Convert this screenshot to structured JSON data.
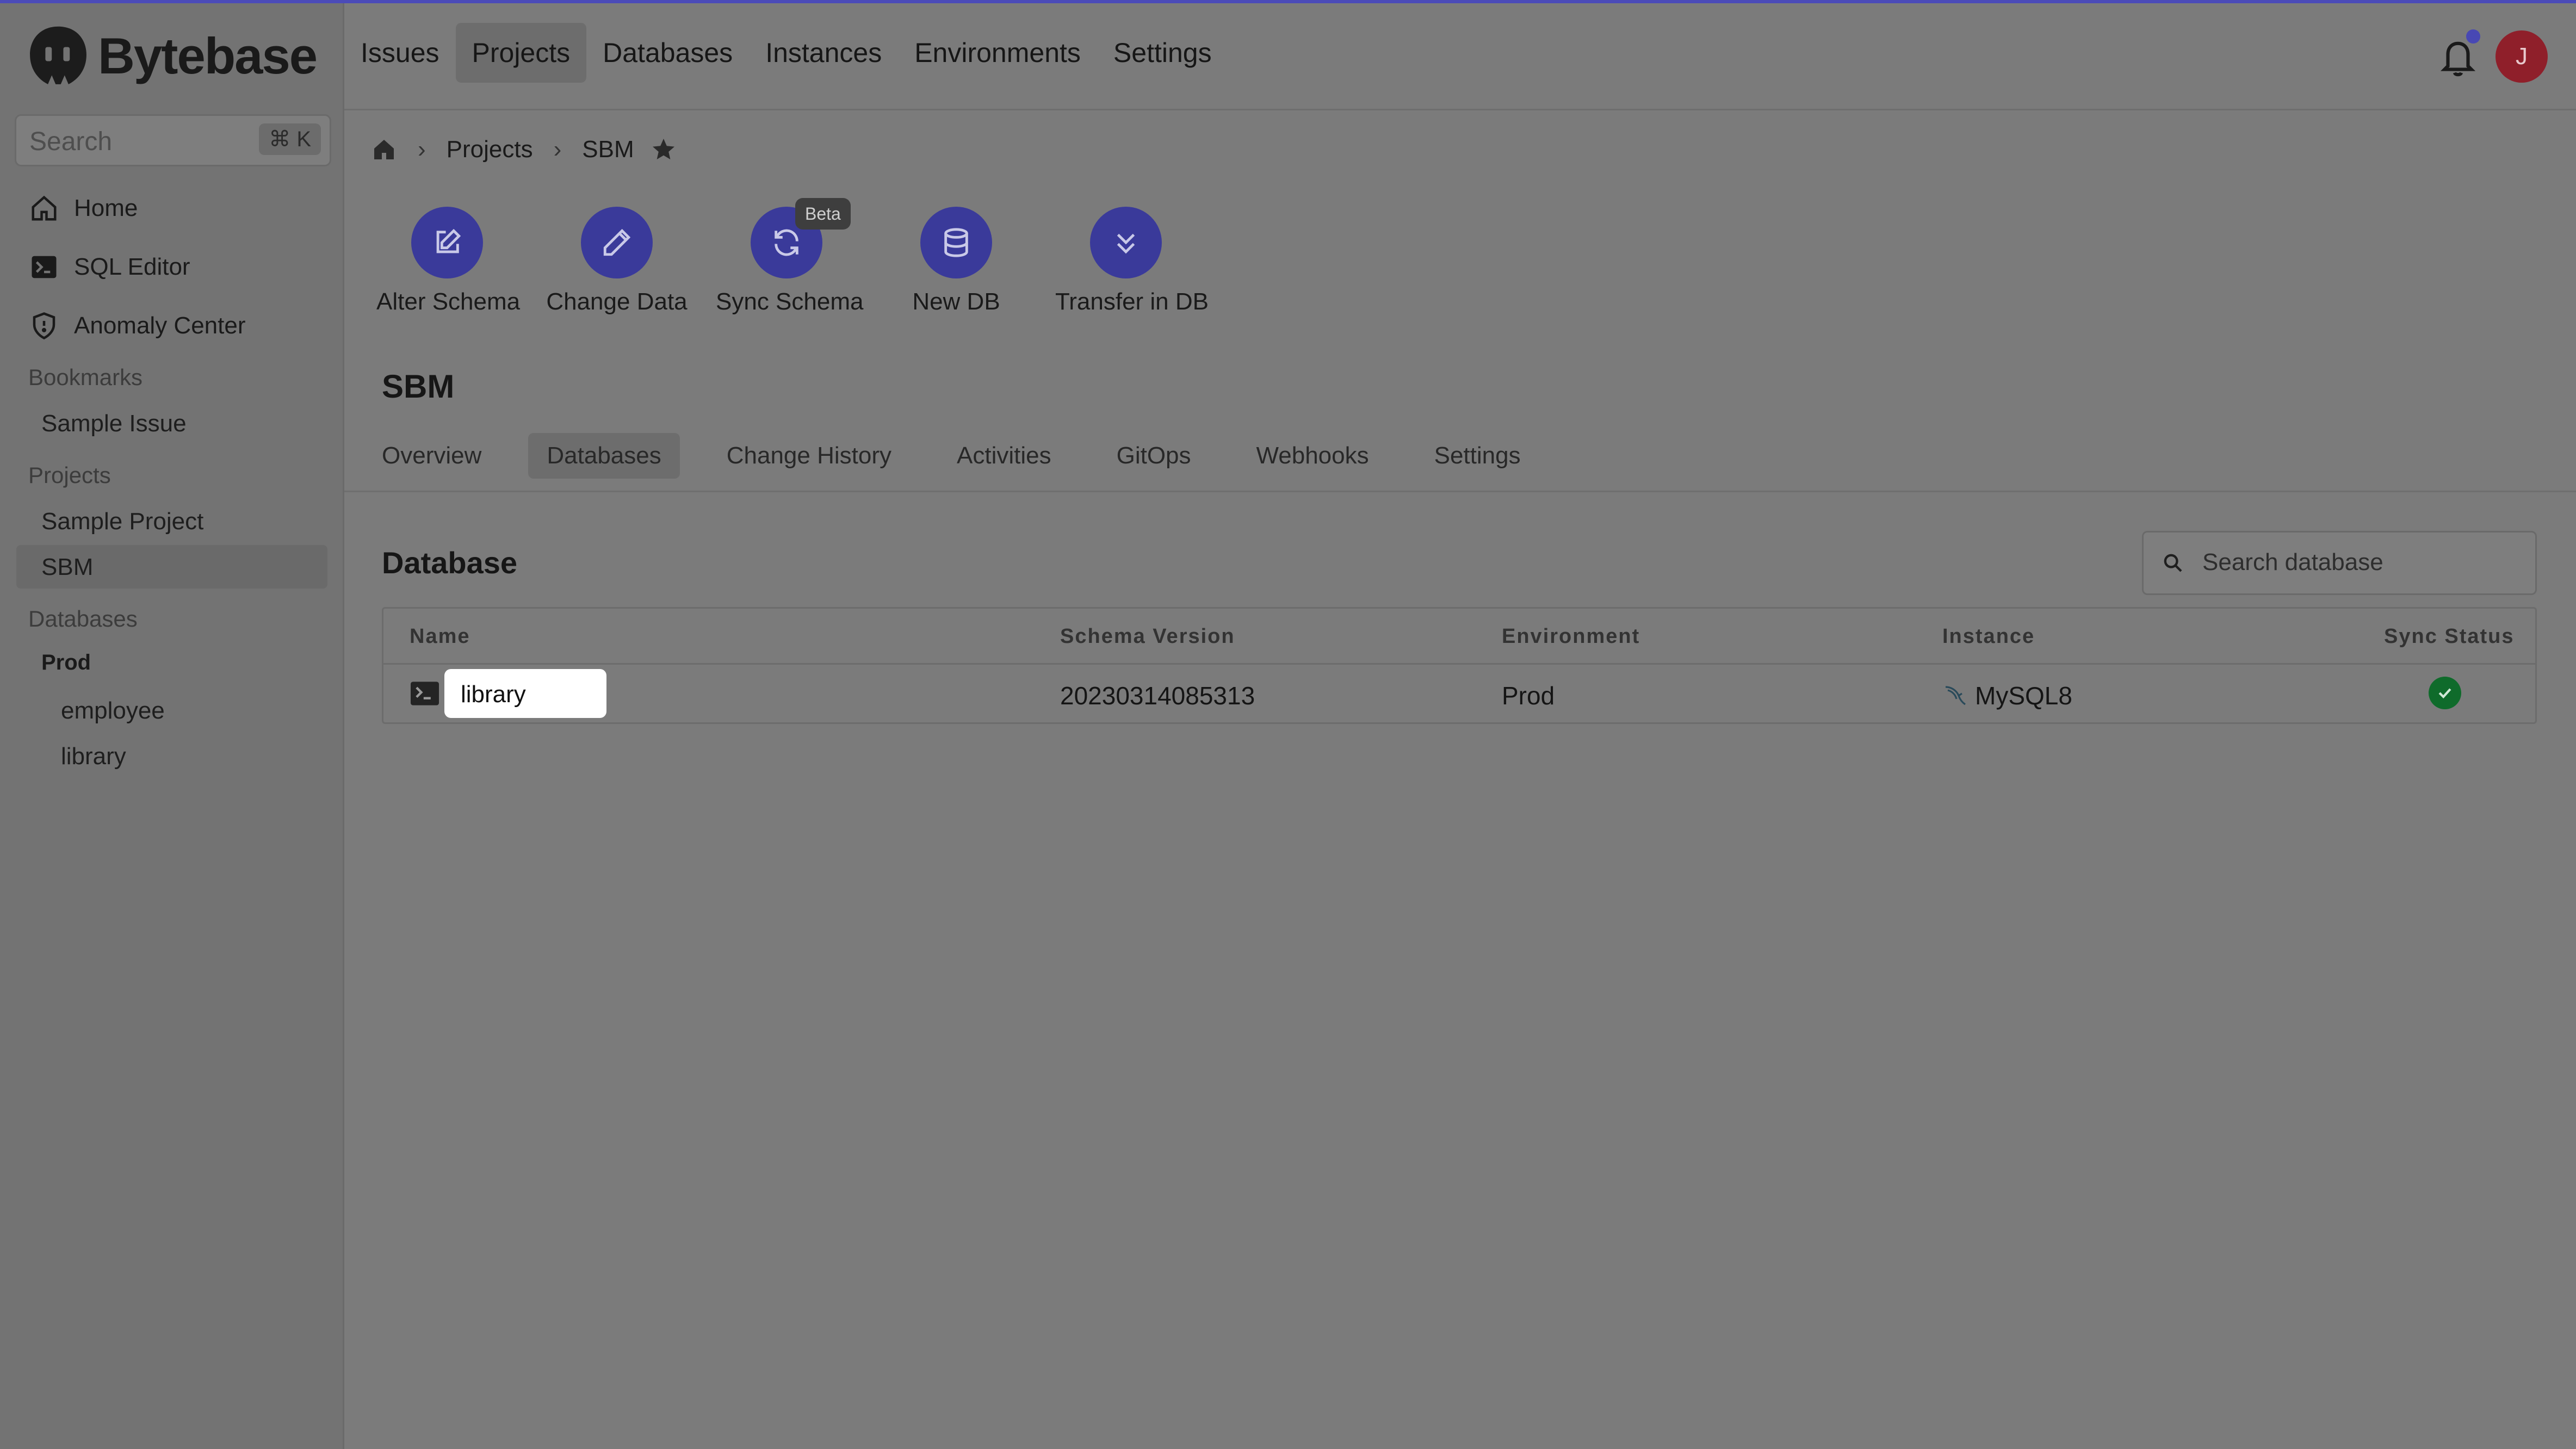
{
  "app": {
    "logo_text": "Bytebase"
  },
  "sidebar": {
    "search_placeholder": "Search",
    "search_shortcut": "⌘ K",
    "nav": [
      {
        "label": "Home",
        "icon": "home-icon"
      },
      {
        "label": "SQL Editor",
        "icon": "terminal-icon"
      },
      {
        "label": "Anomaly Center",
        "icon": "shield-icon"
      }
    ],
    "bookmarks_label": "Bookmarks",
    "bookmarks": [
      "Sample Issue"
    ],
    "projects_label": "Projects",
    "projects": [
      "Sample Project",
      "SBM"
    ],
    "selected_project": "SBM",
    "databases_label": "Databases",
    "db_env": "Prod",
    "databases": [
      "employee",
      "library"
    ]
  },
  "header": {
    "nav": [
      "Issues",
      "Projects",
      "Databases",
      "Instances",
      "Environments",
      "Settings"
    ],
    "active_nav": "Projects",
    "avatar_initial": "J",
    "notification_dot_color": "#4848b4"
  },
  "breadcrumb": {
    "items": [
      "Projects",
      "SBM"
    ],
    "home_icon": "home-icon",
    "star_icon": "star-icon"
  },
  "quick_actions": [
    {
      "label": "Alter Schema",
      "icon": "edit-square-icon"
    },
    {
      "label": "Change Data",
      "icon": "pencil-icon"
    },
    {
      "label": "Sync Schema",
      "icon": "sync-icon",
      "badge": "Beta"
    },
    {
      "label": "New DB",
      "icon": "database-icon"
    },
    {
      "label": "Transfer in DB",
      "icon": "chevrons-down-icon"
    }
  ],
  "project": {
    "title": "SBM",
    "tabs": [
      "Overview",
      "Databases",
      "Change History",
      "Activities",
      "GitOps",
      "Webhooks",
      "Settings"
    ],
    "active_tab": "Databases"
  },
  "database_section": {
    "heading": "Database",
    "search_placeholder": "Search database",
    "columns": [
      "Name",
      "Schema Version",
      "Environment",
      "Instance",
      "Sync Status"
    ],
    "rows": [
      {
        "name": "library",
        "schema_version": "20230314085313",
        "environment": "Prod",
        "instance": "MySQL8",
        "sync_status": "ok"
      }
    ]
  },
  "colors": {
    "accent": "#3a3a9a",
    "sync_ok": "#0f6b2b",
    "avatar": "#8f1f2a"
  }
}
